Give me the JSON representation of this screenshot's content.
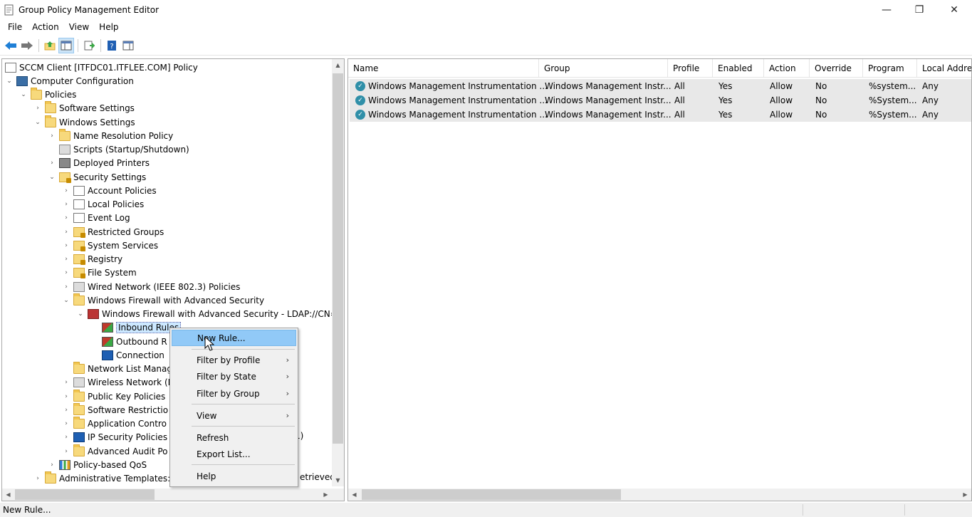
{
  "window": {
    "title": "Group Policy Management Editor",
    "minimize": "—",
    "maximize": "❐",
    "close": "✕"
  },
  "menu": [
    "File",
    "Action",
    "View",
    "Help"
  ],
  "tree": {
    "items": [
      {
        "label": "SCCM Client [ITFDC01.ITFLEE.COM] Policy",
        "icon": "policy-icon",
        "expander": ""
      },
      {
        "label": "Computer Configuration",
        "icon": "computer-icon",
        "expander": "⌄"
      },
      {
        "label": "Policies",
        "icon": "folder-icon",
        "expander": "⌄"
      },
      {
        "label": "Software Settings",
        "icon": "folder-icon",
        "expander": "›"
      },
      {
        "label": "Windows Settings",
        "icon": "folder-icon",
        "expander": "⌄"
      },
      {
        "label": "Name Resolution Policy",
        "icon": "folder-icon",
        "expander": "›"
      },
      {
        "label": "Scripts (Startup/Shutdown)",
        "icon": "script-icon",
        "expander": ""
      },
      {
        "label": "Deployed Printers",
        "icon": "printer-icon",
        "expander": "›"
      },
      {
        "label": "Security Settings",
        "icon": "security-icon",
        "expander": "⌄"
      },
      {
        "label": "Account Policies",
        "icon": "policy-icon",
        "expander": "›"
      },
      {
        "label": "Local Policies",
        "icon": "policy-icon",
        "expander": "›"
      },
      {
        "label": "Event Log",
        "icon": "policy-icon",
        "expander": "›"
      },
      {
        "label": "Restricted Groups",
        "icon": "lock-folder-icon",
        "expander": "›"
      },
      {
        "label": "System Services",
        "icon": "lock-folder-icon",
        "expander": "›"
      },
      {
        "label": "Registry",
        "icon": "lock-folder-icon",
        "expander": "›"
      },
      {
        "label": "File System",
        "icon": "lock-folder-icon",
        "expander": "›"
      },
      {
        "label": "Wired Network (IEEE 802.3) Policies",
        "icon": "network-icon",
        "expander": "›"
      },
      {
        "label": "Windows Firewall with Advanced Security",
        "icon": "folder-icon",
        "expander": "⌄"
      },
      {
        "label": "Windows Firewall with Advanced Security - LDAP://CN=",
        "icon": "firewall-icon",
        "expander": "⌄"
      },
      {
        "label": "Inbound Rules",
        "icon": "inbound-rules-icon",
        "expander": ""
      },
      {
        "label": "Outbound R",
        "icon": "outbound-rules-icon",
        "expander": ""
      },
      {
        "label": "Connection",
        "icon": "connection-icon",
        "expander": ""
      },
      {
        "label": "Network List Manag",
        "icon": "folder-icon",
        "expander": ""
      },
      {
        "label": "Wireless Network (I",
        "icon": "network-icon",
        "expander": "›"
      },
      {
        "label": "Public Key Policies",
        "icon": "folder-icon",
        "expander": "›"
      },
      {
        "label": "Software Restrictio",
        "icon": "folder-icon",
        "expander": "›"
      },
      {
        "label": "Application Contro",
        "icon": "folder-icon",
        "expander": "›"
      },
      {
        "label": "IP Security Policies",
        "icon": "ipsec-icon",
        "expander": "›"
      },
      {
        "label": "Advanced Audit Po",
        "icon": "folder-icon",
        "expander": "›"
      },
      {
        "label": "Policy-based QoS",
        "icon": "chart-icon",
        "expander": "›"
      },
      {
        "label": "Administrative Templates:",
        "icon": "folder-icon",
        "expander": "›"
      }
    ],
    "clipped_1": "1)",
    "clipped_2": "etrieved"
  },
  "table": {
    "columns": [
      "Name",
      "Group",
      "Profile",
      "Enabled",
      "Action",
      "Override",
      "Program",
      "Local Addre"
    ],
    "rows": [
      [
        "Windows Management Instrumentation ...",
        "Windows Management Instr...",
        "All",
        "Yes",
        "Allow",
        "No",
        "%system...",
        "Any"
      ],
      [
        "Windows Management Instrumentation ...",
        "Windows Management Instr...",
        "All",
        "Yes",
        "Allow",
        "No",
        "%System...",
        "Any"
      ],
      [
        "Windows Management Instrumentation ...",
        "Windows Management Instr...",
        "All",
        "Yes",
        "Allow",
        "No",
        "%System...",
        "Any"
      ]
    ]
  },
  "context_menu": {
    "items": [
      {
        "label": "New Rule...",
        "submenu": false
      },
      {
        "label": "Filter by Profile",
        "submenu": true
      },
      {
        "label": "Filter by State",
        "submenu": true
      },
      {
        "label": "Filter by Group",
        "submenu": true
      },
      {
        "label": "View",
        "submenu": true
      },
      {
        "label": "Refresh",
        "submenu": false
      },
      {
        "label": "Export List...",
        "submenu": false
      },
      {
        "label": "Help",
        "submenu": false
      }
    ],
    "submenu_glyph": "›"
  },
  "status": {
    "text": "New Rule..."
  },
  "colors": {
    "accent": "#91c9f7",
    "selection": "#cce8ff",
    "row_bg": "#e8e8e8"
  }
}
